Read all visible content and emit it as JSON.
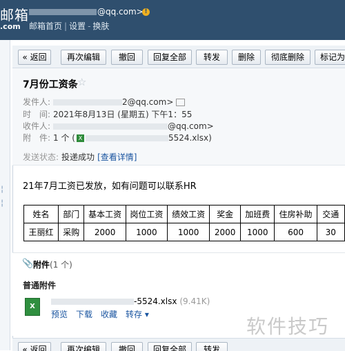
{
  "header": {
    "logo_text": "邮箱",
    "logo_sub": ".com",
    "account": "@qq.com>",
    "links": [
      "邮箱首页",
      "设置",
      "换肤"
    ]
  },
  "toolbar": {
    "buttons": [
      "« 返回",
      "再次编辑",
      "撤回",
      "回复全部",
      "转发",
      "删除",
      "彻底删除",
      "标记为"
    ]
  },
  "mail": {
    "subject": "7月份工资条",
    "sender_label": "发件人:",
    "sender_value": "2@qq.com>",
    "time_label": "时　间:",
    "time_value": "2021年8月13日 (星期五) 下午1：55",
    "recipient_label": "收件人:",
    "recipient_value": "@qq.com>",
    "attachment_label": "附　件:",
    "attachment_count": "1 个 (",
    "attachment_name": "5524.xlsx)",
    "status_label": "发送状态:",
    "status_value": "投递成功",
    "status_link": "[查看详情]",
    "body": "21年7月工资已发放，如有问题可以联系HR"
  },
  "salary_table": {
    "headers": [
      "姓名",
      "部门",
      "基本工资",
      "岗位工资",
      "绩效工资",
      "奖金",
      "加班费",
      "住房补助",
      "交通"
    ],
    "row": [
      "王丽红",
      "采购",
      "2000",
      "1000",
      "1000",
      "2000",
      "1000",
      "600",
      "30"
    ]
  },
  "attachments": {
    "title": "附件",
    "count": "(1 个)",
    "normal_label": "普通附件",
    "file_name": "-5524.xlsx",
    "file_size": "(9.41K)",
    "actions": [
      "预览",
      "下载",
      "收藏",
      "转存 ▾"
    ]
  },
  "watermark": "软件技巧"
}
